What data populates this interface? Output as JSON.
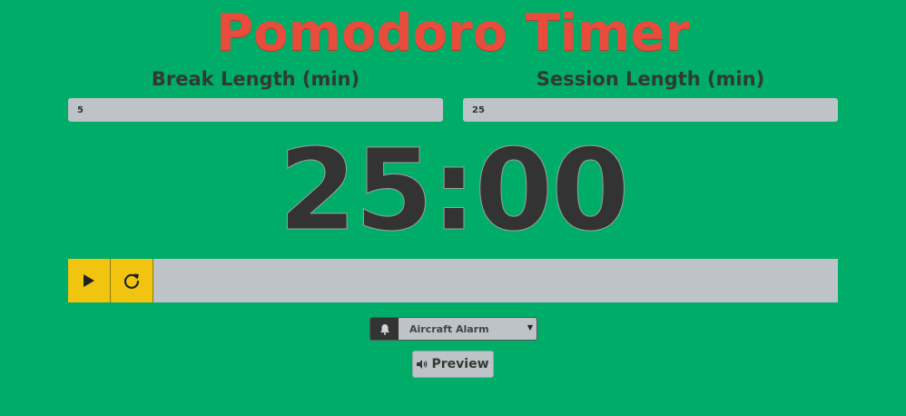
{
  "app": {
    "title": "Pomodoro Timer"
  },
  "break": {
    "label": "Break Length (min)",
    "value": "5"
  },
  "session": {
    "label": "Session Length (min)",
    "value": "25"
  },
  "timer": {
    "display": "25:00",
    "progress": 0
  },
  "controls": {
    "play_icon": "play-icon",
    "reset_icon": "reset-icon"
  },
  "alarm": {
    "icon": "bell-icon",
    "selected": "Aircraft Alarm"
  },
  "preview": {
    "icon": "speaker-icon",
    "label": "Preview"
  },
  "colors": {
    "background": "#00ad68",
    "title": "#e74c3c",
    "accent": "#f1c40f",
    "panel": "#bdc3c7",
    "text_dark": "#333333"
  }
}
